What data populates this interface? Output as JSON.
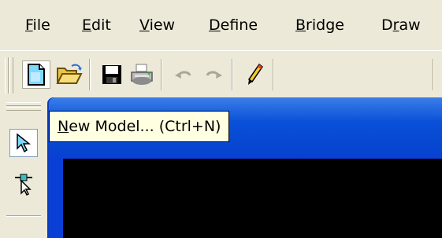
{
  "menubar": {
    "items": [
      {
        "accel": "F",
        "rest": "ile"
      },
      {
        "accel": "E",
        "rest": "dit"
      },
      {
        "accel": "V",
        "rest": "iew"
      },
      {
        "accel": "D",
        "rest": "efine"
      },
      {
        "accel": "B",
        "rest": "ridge"
      },
      {
        "pre": "D",
        "accel": "r",
        "rest": "aw"
      }
    ]
  },
  "toolbar": {
    "icons": [
      "new-model-icon",
      "open-folder-icon",
      "save-icon",
      "print-icon",
      "undo-icon",
      "redo-icon",
      "pencil-icon"
    ]
  },
  "left_toolbar": {
    "icons": [
      "pointer-icon",
      "reshape-pointer-icon"
    ]
  },
  "tooltip": {
    "accel": "N",
    "rest": "ew Model... (Ctrl+N)"
  },
  "colors": {
    "window_title": "#0a50d8",
    "canvas": "#000000",
    "tooltip_bg": "#ffffe1",
    "chrome": "#ece9d8"
  }
}
